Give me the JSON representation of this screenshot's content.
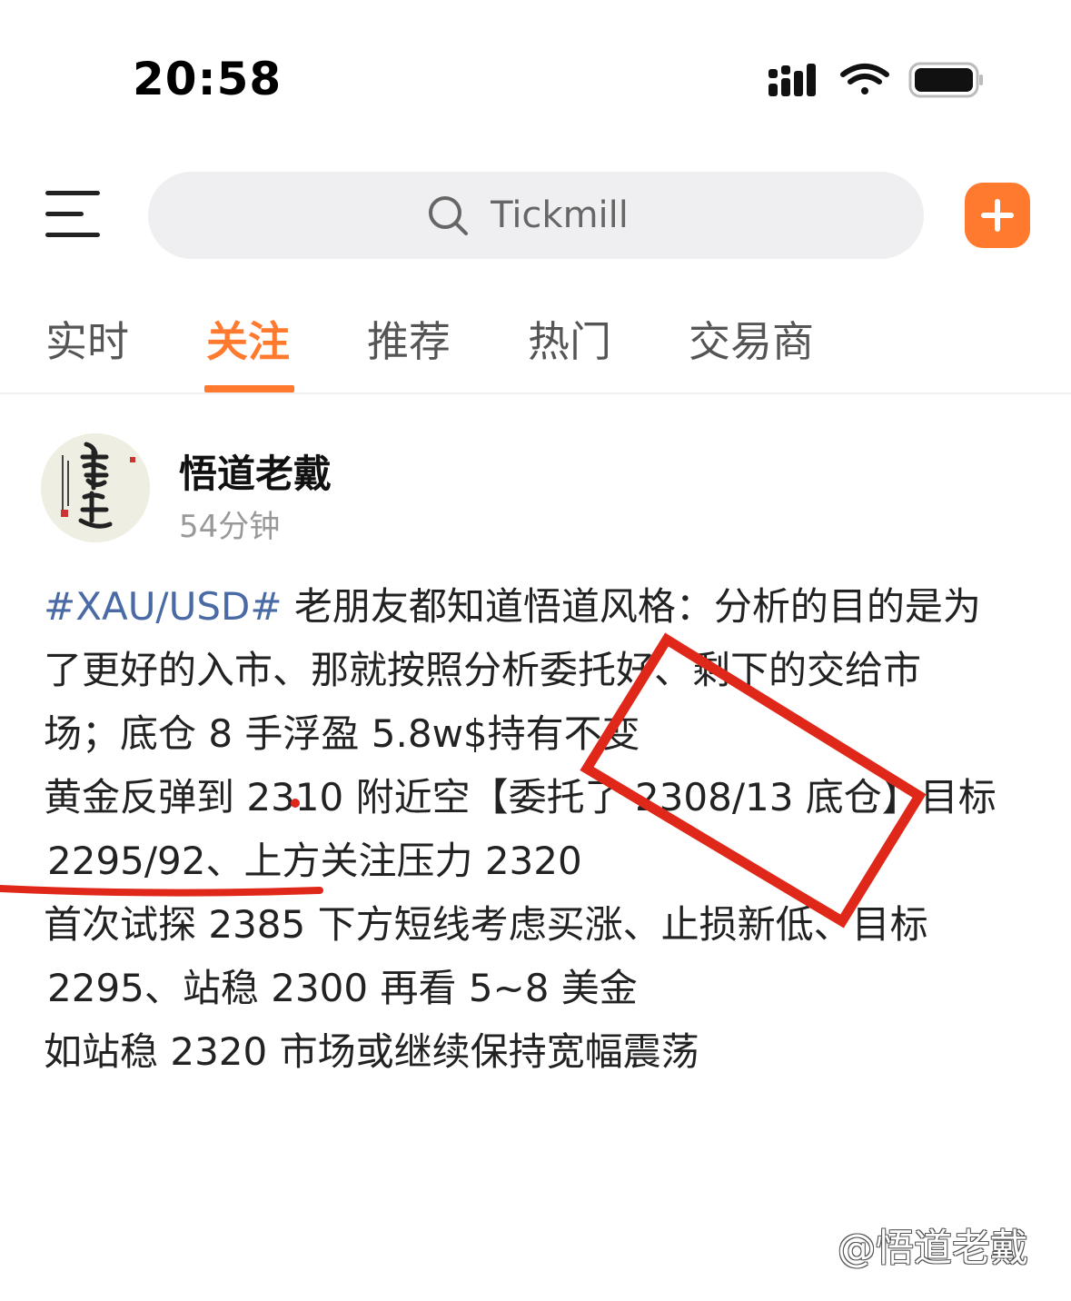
{
  "status_bar": {
    "time": "20:58"
  },
  "header": {
    "search_placeholder": "Tickmill"
  },
  "tabs": [
    {
      "label": "实时"
    },
    {
      "label": "关注"
    },
    {
      "label": "推荐"
    },
    {
      "label": "热门"
    },
    {
      "label": "交易商"
    }
  ],
  "post": {
    "author": "悟道老戴",
    "time": "54分钟",
    "hashtag": "#XAU/USD#",
    "lines": [
      " 老朋友都知道悟道风格：分析的目的是为",
      "了更好的入市、那就按照分析委托好、剩下的交给市",
      "场；底仓 8 手浮盈 5.8w$持有不变",
      "黄金反弹到 2310 附近空【委托了 2308/13 底仓】目标",
      "2295/92、上方关注压力 2320",
      "首次试探 2385 下方短线考虑买涨、止损新低、目标",
      "2295、站稳 2300 再看 5~8 美金",
      "如站稳 2320 市场或继续保持宽幅震荡"
    ]
  },
  "watermark": "@悟道老戴",
  "colors": {
    "accent": "#ff7a2f",
    "hashtag": "#4a6aa5",
    "annotation": "#e0281a"
  }
}
